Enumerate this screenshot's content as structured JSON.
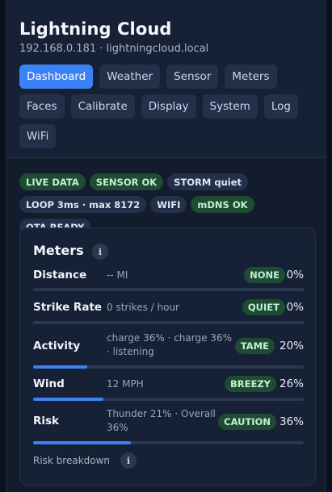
{
  "header": {
    "title": "Lightning Cloud",
    "subtitle": "192.168.0.181 · lightningcloud.local"
  },
  "tabs": [
    {
      "label": "Dashboard",
      "active": true
    },
    {
      "label": "Weather"
    },
    {
      "label": "Sensor"
    },
    {
      "label": "Meters"
    },
    {
      "label": "Faces"
    },
    {
      "label": "Calibrate"
    },
    {
      "label": "Display"
    },
    {
      "label": "System"
    },
    {
      "label": "Log"
    },
    {
      "label": "WiFi"
    }
  ],
  "badges": [
    {
      "label": "LIVE DATA",
      "ok": true
    },
    {
      "label": "SENSOR OK",
      "ok": true
    },
    {
      "label": "STORM quiet"
    },
    {
      "label": "LOOP 3ms · max 8172"
    },
    {
      "label": "WIFI"
    },
    {
      "label": "mDNS OK",
      "ok": true
    },
    {
      "label": "OTA READY"
    }
  ],
  "meters": {
    "title": "Meters",
    "info_icon": "i",
    "breakdown_label": "Risk breakdown",
    "items": [
      {
        "label": "Distance",
        "detail": "-- MI",
        "status": "NONE",
        "percent": "0%",
        "fill": 0
      },
      {
        "label": "Strike Rate",
        "detail": "0 strikes / hour",
        "status": "QUIET",
        "percent": "0%",
        "fill": 0
      },
      {
        "label": "Activity",
        "detail": "charge 36% · charge 36% · listening",
        "status": "TAME",
        "percent": "20%",
        "fill": 20
      },
      {
        "label": "Wind",
        "detail": "12 MPH",
        "status": "BREEZY",
        "percent": "26%",
        "fill": 26
      },
      {
        "label": "Risk",
        "detail": "Thunder 21% · Overall 36%",
        "status": "CAUTION",
        "percent": "36%",
        "fill": 36
      }
    ]
  },
  "colors": {
    "accent": "#3b82f6",
    "ok_badge_bg": "#1f4a34",
    "ok_badge_text": "#bff2cf"
  }
}
